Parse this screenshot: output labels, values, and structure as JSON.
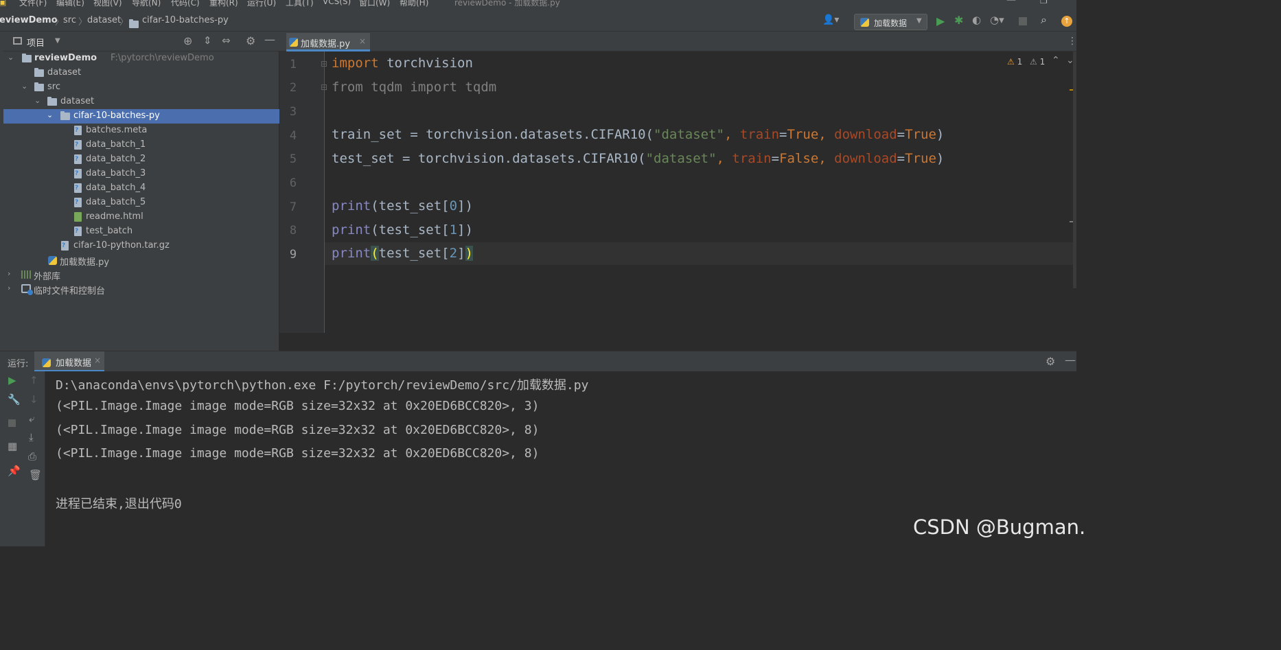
{
  "menu": {
    "items": [
      "文件(F)",
      "编辑(E)",
      "视图(V)",
      "导航(N)",
      "代码(C)",
      "重构(R)",
      "运行(U)",
      "工具(T)",
      "VCS(S)",
      "窗口(W)",
      "帮助(H)"
    ],
    "window_title": "reviewDemo - 加载数据.py"
  },
  "breadcrumb": {
    "project": "eviewDemo",
    "src": "src",
    "dataset": "dataset",
    "folder": "cifar-10-batches-py"
  },
  "run_config": {
    "label": "加载数据"
  },
  "project_panel": {
    "title": "项目",
    "root": "reviewDemo",
    "root_path": "F:\\pytorch\\reviewDemo",
    "tree": [
      {
        "label": "dataset"
      },
      {
        "label": "src"
      },
      {
        "label": "dataset"
      },
      {
        "label": "cifar-10-batches-py"
      },
      {
        "label": "batches.meta"
      },
      {
        "label": "data_batch_1"
      },
      {
        "label": "data_batch_2"
      },
      {
        "label": "data_batch_3"
      },
      {
        "label": "data_batch_4"
      },
      {
        "label": "data_batch_5"
      },
      {
        "label": "readme.html"
      },
      {
        "label": "test_batch"
      },
      {
        "label": "cifar-10-python.tar.gz"
      },
      {
        "label": "加载数据.py"
      },
      {
        "label": "外部库"
      },
      {
        "label": "临时文件和控制台"
      }
    ]
  },
  "editor": {
    "tab": "加载数据.py",
    "warnings_a": "1",
    "warnings_b": "1",
    "line_numbers": [
      "1",
      "2",
      "3",
      "4",
      "5",
      "6",
      "7",
      "8",
      "9"
    ],
    "code": {
      "l1_kw": "import",
      "l1_rest": " torchvision",
      "l2": "from tqdm import tqdm",
      "l4_a": "train_set = torchvision.datasets.CIFAR10(",
      "l4_str": "\"dataset\"",
      "l4_c1": ", ",
      "l4_p1": "train",
      "l4_eq1": "=",
      "l4_v1": "True",
      "l4_c2": ", ",
      "l4_p2": "download",
      "l4_eq2": "=",
      "l4_v2": "True",
      "l4_end": ")",
      "l5_a": "test_set = torchvision.datasets.CIFAR10(",
      "l5_str": "\"dataset\"",
      "l5_c1": ", ",
      "l5_p1": "train",
      "l5_eq1": "=",
      "l5_v1": "False",
      "l5_c2": ", ",
      "l5_p2": "download",
      "l5_eq2": "=",
      "l5_v2": "True",
      "l5_end": ")",
      "print": "print",
      "l7_a": "(test_set[",
      "l7_n": "0",
      "l7_b": "])",
      "l8_a": "(test_set[",
      "l8_n": "1",
      "l8_b": "])",
      "l9_open": "(",
      "l9_a": "test_set[",
      "l9_n": "2",
      "l9_b": "]",
      "l9_close": ")"
    }
  },
  "run_panel": {
    "label": "运行:",
    "tab": "加载数据",
    "output": [
      "D:\\anaconda\\envs\\pytorch\\python.exe F:/pytorch/reviewDemo/src/加载数据.py",
      "(<PIL.Image.Image image mode=RGB size=32x32 at 0x20ED6BCC820>, 3)",
      "(<PIL.Image.Image image mode=RGB size=32x32 at 0x20ED6BCC820>, 8)",
      "(<PIL.Image.Image image mode=RGB size=32x32 at 0x20ED6BCC820>, 8)",
      "",
      "进程已结束,退出代码0"
    ]
  },
  "watermark": "CSDN @Bugman.",
  "colors": {
    "keyword": "#cc7832",
    "string": "#6a8759",
    "param": "#aa4926",
    "number": "#6897bb",
    "builtin": "#8888c6",
    "selection": "#4b6eaf"
  }
}
